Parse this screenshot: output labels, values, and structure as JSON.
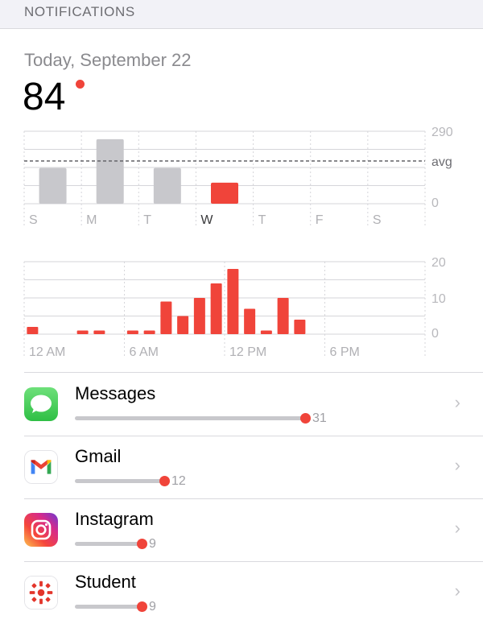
{
  "header": {
    "title": "NOTIFICATIONS"
  },
  "summary": {
    "date": "Today, September 22",
    "count": "84"
  },
  "colors": {
    "accent": "#f0443a",
    "bar_inactive": "#c8c8cc",
    "grid": "#d6d6da"
  },
  "chart_data": [
    {
      "type": "bar",
      "categories": [
        "S",
        "M",
        "T",
        "W",
        "T",
        "F",
        "S"
      ],
      "values": [
        143,
        258,
        143,
        84,
        null,
        null,
        null
      ],
      "highlight_index": 3,
      "y_tick_labels": [
        "290",
        "avg",
        "0"
      ],
      "ylim": [
        0,
        290
      ],
      "average": 171,
      "grid": true
    },
    {
      "type": "bar",
      "x": [
        0,
        1,
        2,
        3,
        4,
        5,
        6,
        7,
        8,
        9,
        10,
        11,
        12,
        13,
        14,
        15,
        16,
        17
      ],
      "values": [
        2,
        0,
        0,
        1,
        1,
        0,
        1,
        1,
        9,
        5,
        10,
        14,
        18,
        7,
        1,
        10,
        4,
        0
      ],
      "x_tick_labels": [
        "12 AM",
        "6 AM",
        "12 PM",
        "6 PM"
      ],
      "y_tick_labels": [
        "20",
        "10",
        "0"
      ],
      "ylim": [
        0,
        20
      ],
      "grid": true
    }
  ],
  "apps": [
    {
      "name": "Messages",
      "count": "31",
      "value": 31,
      "icon": "messages-icon"
    },
    {
      "name": "Gmail",
      "count": "12",
      "value": 12,
      "icon": "gmail-icon"
    },
    {
      "name": "Instagram",
      "count": "9",
      "value": 9,
      "icon": "instagram-icon"
    },
    {
      "name": "Student",
      "count": "9",
      "value": 9,
      "icon": "student-icon"
    }
  ],
  "chevron": "›"
}
